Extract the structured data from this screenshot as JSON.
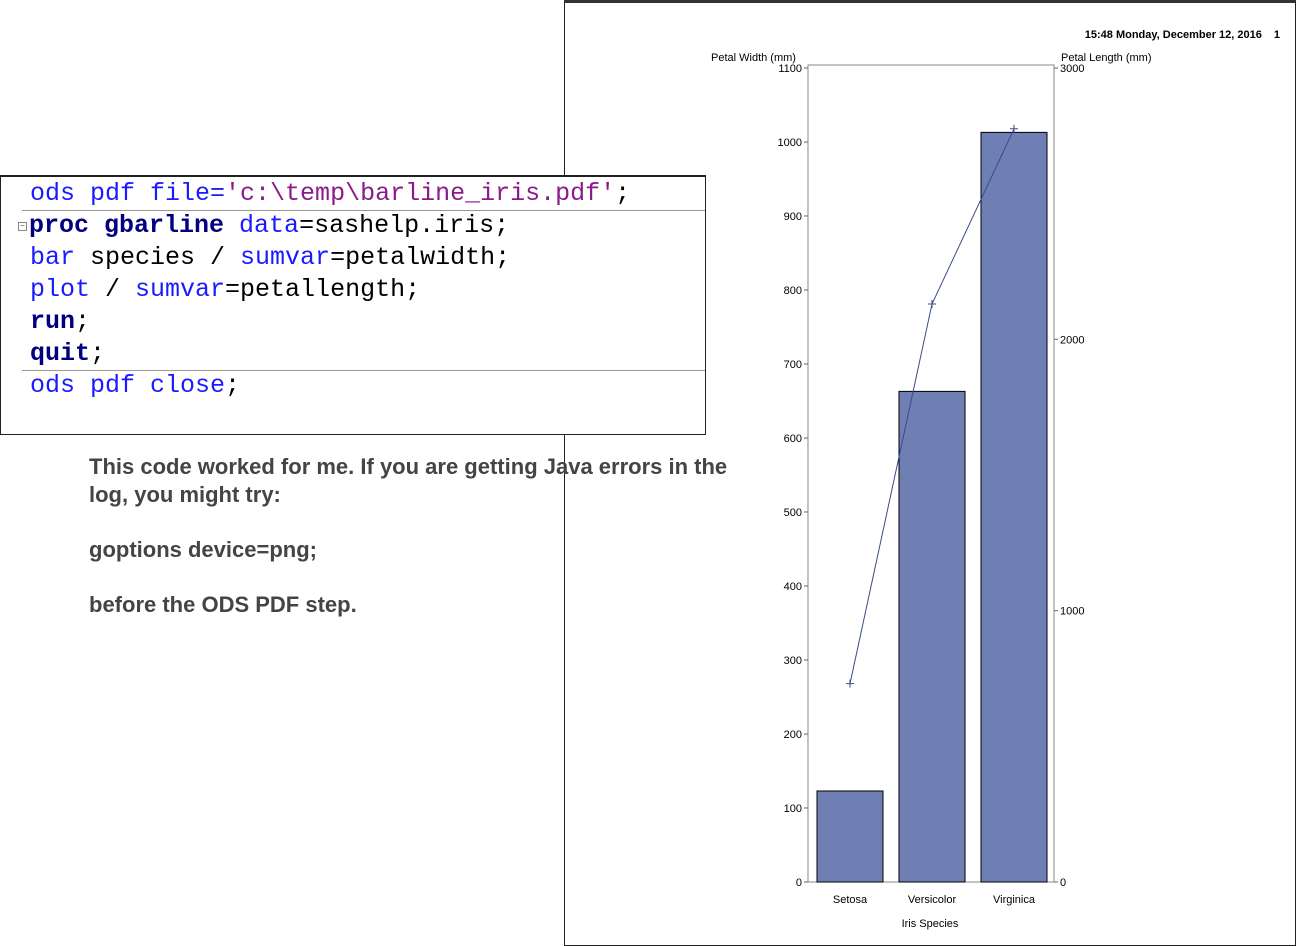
{
  "code": {
    "line1": {
      "kw": "ods pdf file=",
      "str": "'c:\\temp\\barline_iris.pdf'",
      "end": ";"
    },
    "line2": {
      "kw1": "proc gbarline",
      "kw2": " data",
      "rest": "=sashelp.iris;"
    },
    "line3": {
      "kw": "bar",
      "mid": " species / ",
      "kw2": "sumvar",
      "rest": "=petalwidth;"
    },
    "line4": {
      "kw": "plot",
      "mid": " / ",
      "kw2": "sumvar",
      "rest": "=petallength;"
    },
    "line5": {
      "kw": "run",
      "rest": ";"
    },
    "line6": {
      "kw": "quit",
      "rest": ";"
    },
    "line7": {
      "kw": "ods pdf close",
      "rest": ";"
    }
  },
  "note": {
    "p1": "This code worked for me. If you are getting Java errors in the log, you might try:",
    "p2": "goptions device=png;",
    "p3": "before the ODS PDF step."
  },
  "chart_header": {
    "timestamp": "15:48 Monday, December 12, 2016",
    "page": "1"
  },
  "chart_data": {
    "type": "bar",
    "categories": [
      "Setosa",
      "Versicolor",
      "Virginica"
    ],
    "xlabel": "Iris Species",
    "series": [
      {
        "name": "Petal Width (mm)",
        "kind": "bar",
        "axis": "left",
        "values": [
          123,
          663,
          1013
        ],
        "color": "#6f7fb4"
      },
      {
        "name": "Petal Length (mm)",
        "kind": "line",
        "axis": "right",
        "values": [
          731,
          2130,
          2776
        ],
        "color": "#3a4a8a"
      }
    ],
    "ylabel": "Petal Width (mm)",
    "ylim": [
      0,
      1100
    ],
    "yticks": [
      0,
      100,
      200,
      300,
      400,
      500,
      600,
      700,
      800,
      900,
      1000,
      1100
    ],
    "y2label": "Petal Length (mm)",
    "y2lim": [
      0,
      3000
    ],
    "y2ticks": [
      0,
      1000,
      2000,
      3000
    ]
  }
}
